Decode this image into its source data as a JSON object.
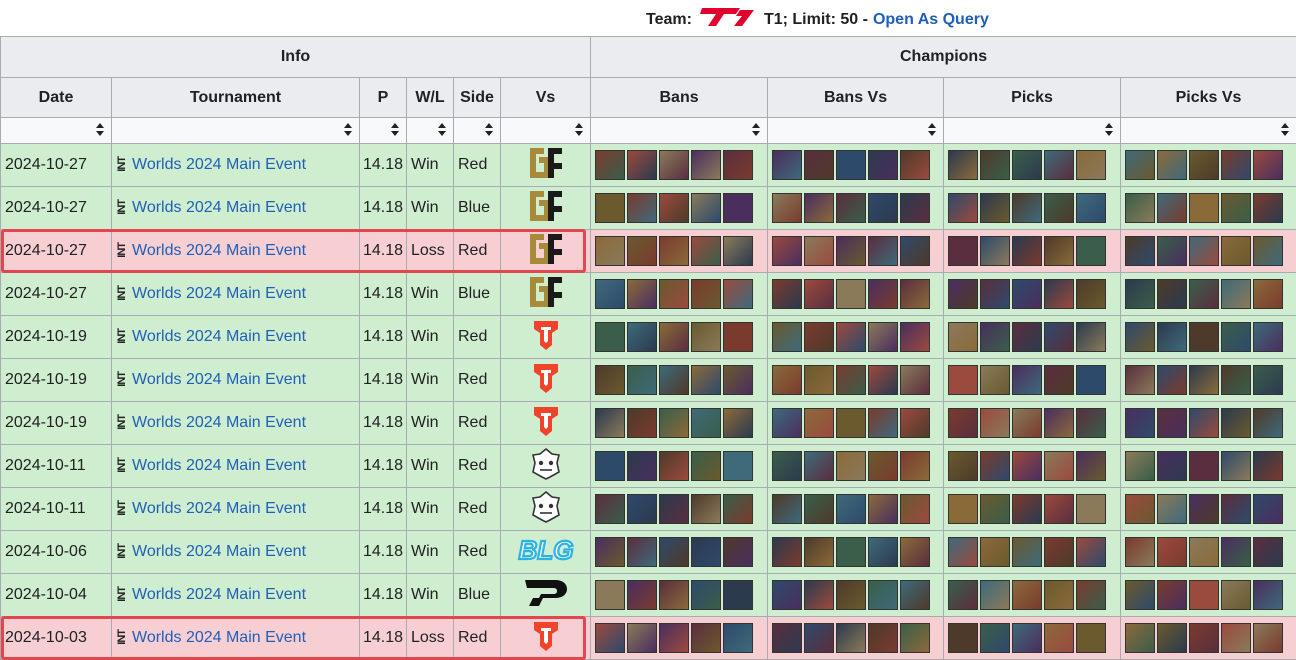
{
  "caption": {
    "team_label": "Team:",
    "team_suffix": "T1; Limit: 50 -",
    "query_link": "Open As Query",
    "t1_color": "#e2012d"
  },
  "header": {
    "group_info": "Info",
    "group_champions": "Champions",
    "columns": [
      "Date",
      "Tournament",
      "P",
      "W/L",
      "Side",
      "Vs",
      "Bans",
      "Bans Vs",
      "Picks",
      "Picks Vs"
    ]
  },
  "colors": {
    "win_bg": "#cfeecf",
    "loss_bg": "#f7cfd3",
    "highlight": "#e2474f",
    "link": "#1f5fb8"
  },
  "rows": [
    {
      "date": "2024-10-27",
      "tournament": "Worlds 2024 Main Event",
      "patch": "14.18",
      "result": "Win",
      "side": "Red",
      "vs": "gen-g-icon",
      "highlight": false
    },
    {
      "date": "2024-10-27",
      "tournament": "Worlds 2024 Main Event",
      "patch": "14.18",
      "result": "Win",
      "side": "Blue",
      "vs": "gen-g-icon",
      "highlight": false
    },
    {
      "date": "2024-10-27",
      "tournament": "Worlds 2024 Main Event",
      "patch": "14.18",
      "result": "Loss",
      "side": "Red",
      "vs": "gen-g-icon",
      "highlight": true
    },
    {
      "date": "2024-10-27",
      "tournament": "Worlds 2024 Main Event",
      "patch": "14.18",
      "result": "Win",
      "side": "Blue",
      "vs": "gen-g-icon",
      "highlight": false
    },
    {
      "date": "2024-10-19",
      "tournament": "Worlds 2024 Main Event",
      "patch": "14.18",
      "result": "Win",
      "side": "Red",
      "vs": "top-esports-icon",
      "highlight": false
    },
    {
      "date": "2024-10-19",
      "tournament": "Worlds 2024 Main Event",
      "patch": "14.18",
      "result": "Win",
      "side": "Red",
      "vs": "top-esports-icon",
      "highlight": false
    },
    {
      "date": "2024-10-19",
      "tournament": "Worlds 2024 Main Event",
      "patch": "14.18",
      "result": "Win",
      "side": "Red",
      "vs": "top-esports-icon",
      "highlight": false
    },
    {
      "date": "2024-10-11",
      "tournament": "Worlds 2024 Main Event",
      "patch": "14.18",
      "result": "Win",
      "side": "Red",
      "vs": "g2-esports-icon",
      "highlight": false
    },
    {
      "date": "2024-10-11",
      "tournament": "Worlds 2024 Main Event",
      "patch": "14.18",
      "result": "Win",
      "side": "Red",
      "vs": "g2-esports-icon",
      "highlight": false
    },
    {
      "date": "2024-10-06",
      "tournament": "Worlds 2024 Main Event",
      "patch": "14.18",
      "result": "Win",
      "side": "Red",
      "vs": "blg-icon",
      "highlight": false
    },
    {
      "date": "2024-10-04",
      "tournament": "Worlds 2024 Main Event",
      "patch": "14.18",
      "result": "Win",
      "side": "Blue",
      "vs": "pain-gaming-icon",
      "highlight": false
    },
    {
      "date": "2024-10-03",
      "tournament": "Worlds 2024 Main Event",
      "patch": "14.18",
      "result": "Loss",
      "side": "Red",
      "vs": "top-esports-icon",
      "highlight": true
    }
  ],
  "champion_icon_palette": [
    "#7a3b2e",
    "#2e4a6b",
    "#8b6a3a",
    "#4a2e5e",
    "#3a5e4a",
    "#9b4a3e",
    "#2c3a4e",
    "#6a5a2e",
    "#5a2e3e",
    "#3e6a7a",
    "#8a7a5a",
    "#4e3a2a"
  ]
}
